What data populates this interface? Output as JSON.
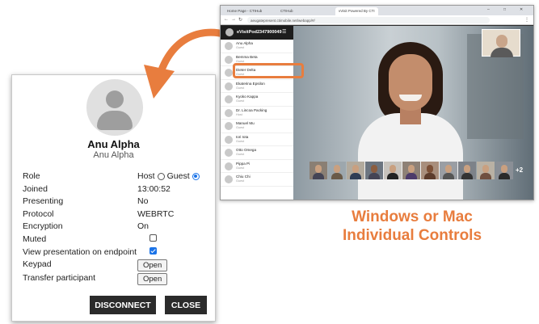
{
  "panel": {
    "name": "Anu Alpha",
    "display_name": "Anu Alpha",
    "rows": {
      "role": {
        "label": "Role",
        "host": "Host",
        "guest": "Guest",
        "selected": "Guest"
      },
      "joined": {
        "label": "Joined",
        "value": "13:00:52"
      },
      "presenting": {
        "label": "Presenting",
        "value": "No"
      },
      "protocol": {
        "label": "Protocol",
        "value": "WEBRTC"
      },
      "encryption": {
        "label": "Encryption",
        "value": "On"
      },
      "muted": {
        "label": "Muted",
        "checked": false
      },
      "view_presentation": {
        "label": "View presentation on endpoint",
        "checked": true
      },
      "keypad": {
        "label": "Keypad",
        "button": "Open"
      },
      "transfer": {
        "label": "Transfer participant",
        "button": "Open"
      }
    },
    "disconnect_label": "DISCONNECT",
    "close_label": "CLOSE",
    "accent": "#1a73e8"
  },
  "browser": {
    "tabs": [
      {
        "label": "Home Page - CTIHub"
      },
      {
        "label": "CTIHub"
      },
      {
        "label": "vVisit Powered By CTI"
      }
    ],
    "url": "aeugatepresent.ctimobile.net/webapp/#/",
    "app": {
      "title": "eVisitPod2347900049",
      "participants": [
        {
          "name": "Anu Alpha",
          "role": "Guest"
        },
        {
          "name": "Bemma Beta",
          "role": "Guest"
        },
        {
          "name": "Dieter Delta",
          "role": "Guest"
        },
        {
          "name": "Ekaterina Epsilon",
          "role": "Guest"
        },
        {
          "name": "Kyoko Kappa",
          "role": "Guest"
        },
        {
          "name": "Dr. Lincoa Packing",
          "role": "Host"
        },
        {
          "name": "Manuel Mu",
          "role": "Guest"
        },
        {
          "name": "Iori Iota",
          "role": "Guest"
        },
        {
          "name": "Otto Omega",
          "role": "Guest"
        },
        {
          "name": "Pippa Pi",
          "role": "Guest"
        },
        {
          "name": "Chiu Chi",
          "role": "Guest"
        }
      ],
      "more_count": "+2"
    }
  },
  "caption": {
    "line1": "Windows or Mac",
    "line2": "Individual Controls",
    "color": "#e87d3e"
  },
  "icons": [
    "person-avatar-icon",
    "curved-arrow-icon",
    "back-icon",
    "forward-icon",
    "reload-icon",
    "menu-icon"
  ]
}
